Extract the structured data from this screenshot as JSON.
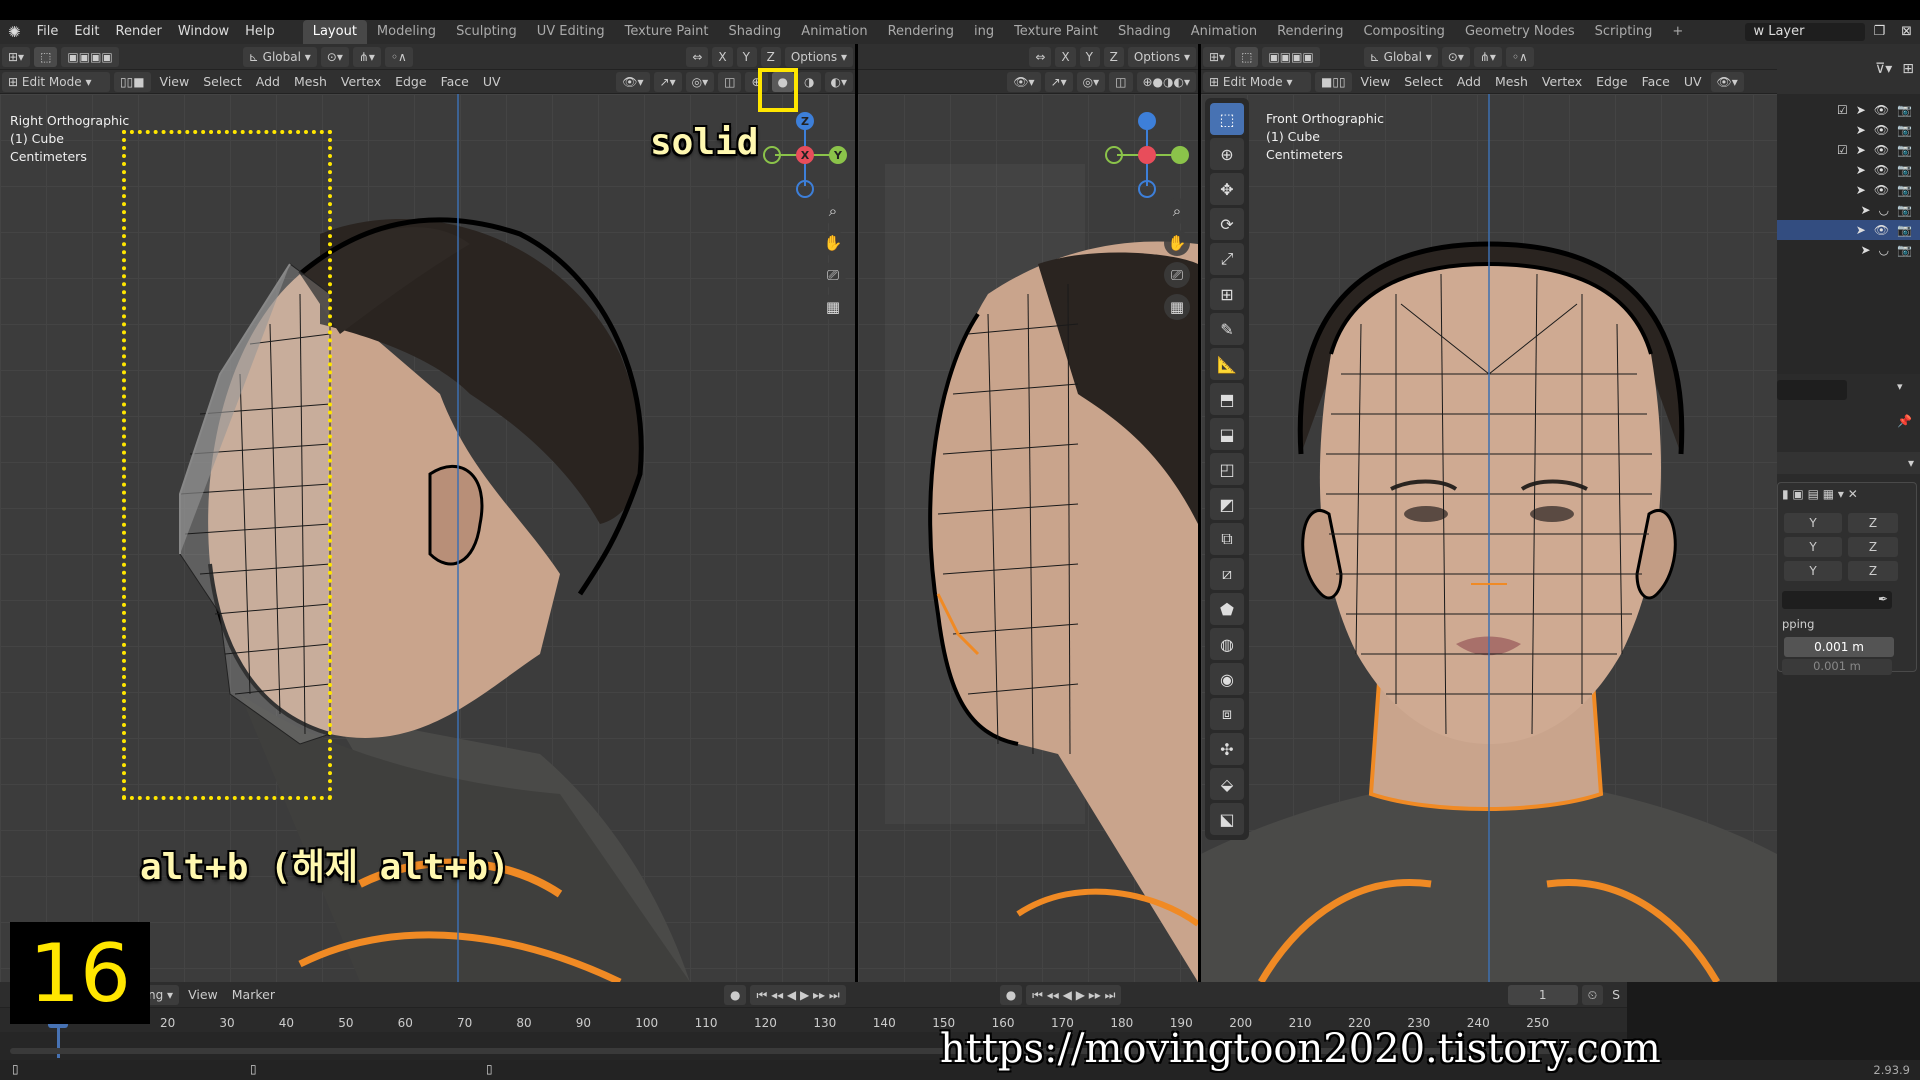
{
  "menubar": {
    "items": [
      "File",
      "Edit",
      "Render",
      "Window",
      "Help"
    ],
    "workspaces_left": [
      "Layout",
      "Modeling",
      "Sculpting",
      "UV Editing",
      "Texture Paint",
      "Shading",
      "Animation",
      "Rendering"
    ],
    "workspaces_right": [
      "ing",
      "Texture Paint",
      "Shading",
      "Animation",
      "Rendering",
      "Compositing",
      "Geometry Nodes",
      "Scripting"
    ],
    "add_tab": "+",
    "view_layer": "w Layer"
  },
  "left_viewport": {
    "transform_orientation": "Global",
    "axes": [
      "X",
      "Y",
      "Z"
    ],
    "options_label": "Options",
    "mode_label": "Edit Mode",
    "menus": [
      "View",
      "Select",
      "Add",
      "Mesh",
      "Vertex",
      "Edge",
      "Face",
      "UV"
    ],
    "info": [
      "Right Orthographic",
      "(1) Cube",
      "Centimeters"
    ],
    "gizmo": {
      "x": "X",
      "y": "Y",
      "z": "Z"
    }
  },
  "middle_viewport": {
    "axes": [
      "X",
      "Y",
      "Z"
    ],
    "options_label": "Options"
  },
  "right_viewport": {
    "transform_orientation": "Global",
    "mode_label": "Edit Mode",
    "menus": [
      "View",
      "Select",
      "Add",
      "Mesh",
      "Vertex",
      "Edge",
      "Face",
      "UV"
    ],
    "info": [
      "Front Orthographic",
      "(1) Cube",
      "Centimeters"
    ]
  },
  "properties": {
    "axis_rows": [
      [
        "Y",
        "Z"
      ],
      [
        "Y",
        "Z"
      ],
      [
        "Y",
        "Z"
      ]
    ],
    "snapping_label": "pping",
    "value1": "0.001 m",
    "value2": "0.001 m"
  },
  "timeline": {
    "menus": [
      "ng",
      "View",
      "Marker"
    ],
    "frame_ticks": [
      "20",
      "30",
      "40",
      "50",
      "60",
      "70",
      "80",
      "90",
      "100",
      "110",
      "120",
      "130",
      "140",
      "150",
      "160",
      "170",
      "180",
      "190",
      "200",
      "210",
      "220",
      "230",
      "240",
      "250"
    ],
    "current_frame": "1",
    "s_label": "S"
  },
  "statusbar": {
    "version": "2.93.9"
  },
  "overlays": {
    "step_number": "16",
    "solid_label": "solid",
    "shortcut_caption": "alt+b (해제 alt+b)",
    "watermark": "https://movingtoon2020.tistory.com"
  },
  "colors": {
    "accent_blue": "#4772b3",
    "highlight_yellow": "#ffe600",
    "axis_x": "#e84d5b",
    "axis_y": "#8bc34a",
    "axis_z": "#3d7fd9",
    "mesh_orange": "#f08a24"
  }
}
